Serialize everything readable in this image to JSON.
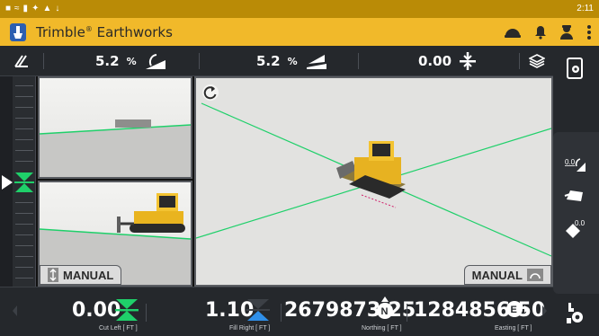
{
  "status_bar": {
    "time": "2:11",
    "icons": [
      "window-icon",
      "signal-icon",
      "battery-icon",
      "location-icon",
      "warning-icon",
      "download-icon"
    ]
  },
  "app": {
    "title": "Trimble",
    "title_mark": "®",
    "title_rest": " Earthworks"
  },
  "info_bar": {
    "cross_slope": {
      "value": "5.2",
      "unit": "%"
    },
    "main_slope": {
      "value": "5.2",
      "unit": "%"
    },
    "elevation_offset": {
      "value": "0.00"
    }
  },
  "views": {
    "left_mode": "MANUAL",
    "right_mode": "MANUAL"
  },
  "readouts": {
    "cut_left": {
      "value": "0.00",
      "label": "Cut Left  [ FT ]"
    },
    "fill_right": {
      "value": "1.10",
      "label": "Fill Right  [ FT ]"
    },
    "northing": {
      "value": "2679873.25",
      "label": "Northing  [ FT ]"
    },
    "easting": {
      "value": "1284856.50",
      "label": "Easting  [ FT ]"
    }
  },
  "side_buttons": {
    "offset_label": "0.0",
    "rotate_label": "0.0"
  },
  "colors": {
    "accent": "#f1b92a",
    "status": "#ba8b06",
    "on_grade": "#1fd06a",
    "fill": "#2f8fe8",
    "panel": "#25282c"
  }
}
